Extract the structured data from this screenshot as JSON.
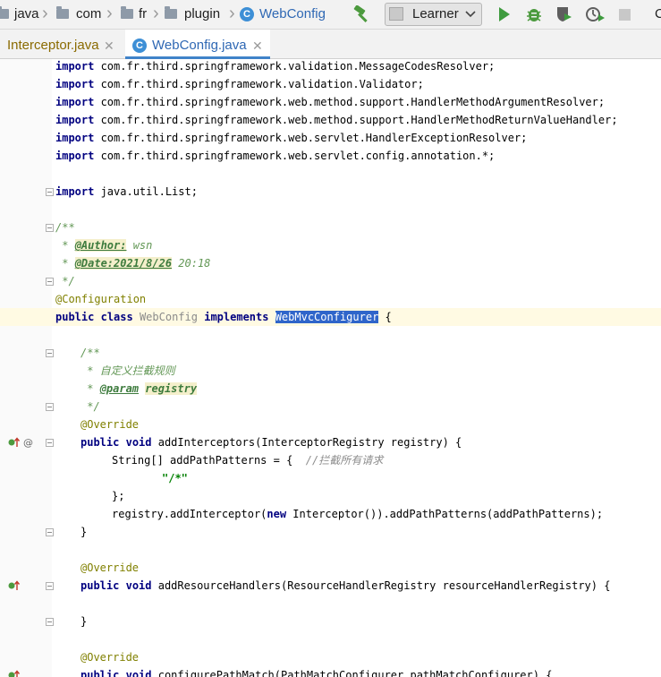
{
  "nav": {
    "crumbs": [
      {
        "label": "java",
        "icon": "folder-icon"
      },
      {
        "label": "com",
        "icon": "folder-icon"
      },
      {
        "label": "fr",
        "icon": "folder-icon"
      },
      {
        "label": "plugin",
        "icon": "folder-icon"
      },
      {
        "label": "WebConfig",
        "icon": "class-icon"
      }
    ],
    "run_config": "Learner",
    "toolbar_icons": [
      "build-hammer-icon",
      "run-icon",
      "debug-icon",
      "coverage-icon",
      "profiler-icon",
      "stop-icon"
    ],
    "cut_off_text": "C"
  },
  "tabs": [
    {
      "label": "Interceptor.java",
      "active": false
    },
    {
      "label": "WebConfig.java",
      "active": true
    }
  ],
  "class_icon_letter": "C",
  "code": {
    "lines": [
      [
        "import",
        " com.fr.third.springframework.validation.MessageCodesResolver;"
      ],
      [
        "import",
        " com.fr.third.springframework.validation.Validator;"
      ],
      [
        "import",
        " com.fr.third.springframework.web.method.support.HandlerMethodArgumentResolver;"
      ],
      [
        "import",
        " com.fr.third.springframework.web.method.support.HandlerMethodReturnValueHandler;"
      ],
      [
        "import",
        " com.fr.third.springframework.web.servlet.HandlerExceptionResolver;"
      ],
      [
        "import",
        " com.fr.third.springframework.web.servlet.config.annotation.*;"
      ],
      [
        "import",
        " java.util.List;"
      ]
    ],
    "javadoc_open": "/**",
    "author_prefix": " * ",
    "author_tag": "@Author:",
    "author_value": " wsn",
    "date_prefix": " * ",
    "date_tag": "@Date:2021/8/26",
    "date_value": " 20:18",
    "javadoc_close": " */",
    "annotation_config": "@Configuration",
    "kw_public": "public",
    "kw_class": "class",
    "class_name": "WebConfig",
    "kw_implements": "implements",
    "interface_name": "WebMvcConfigurer",
    "brace_open": " {",
    "doc2_open": "/**",
    "doc2_line1": " * 自定义拦截规则",
    "doc2_param_prefix": " * ",
    "doc2_param_tag": "@param",
    "doc2_param_space": " ",
    "doc2_param_name": "registry",
    "doc2_close": " */",
    "override": "@Override",
    "kw_void": "void",
    "m1_sig": " addInterceptors(InterceptorRegistry registry) {",
    "m1_l1": "String[] addPathPatterns = {  ",
    "m1_l1_comment": "//拦截所有请求",
    "m1_l2": "\"/*\"",
    "m1_l3": "};",
    "m1_l4a": "registry.addInterceptor(",
    "kw_new": "new",
    "m1_l4b": " Interceptor()).addPathPatterns(addPathPatterns);",
    "close_brace": "}",
    "m2_sig": " addResourceHandlers(ResourceHandlerRegistry resourceHandlerRegistry) {",
    "m3_sig": " configurePathMatch(PathMatchConfigurer pathMatchConfigurer) {"
  }
}
